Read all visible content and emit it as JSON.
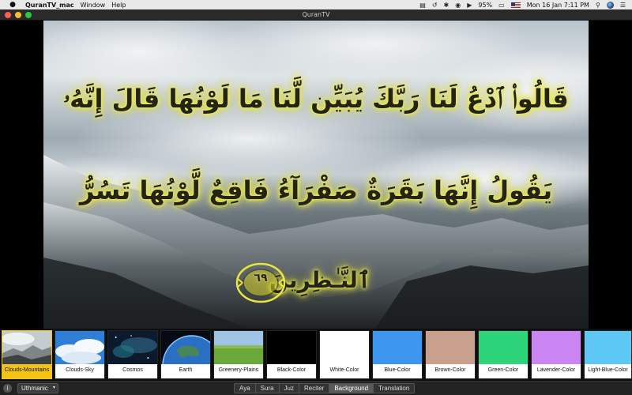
{
  "menubar": {
    "app_name": "QuranTV_mac",
    "menus": [
      "Window",
      "Help"
    ],
    "battery": "95%",
    "clock": "Mon 16 Jan  7:11 PM"
  },
  "window": {
    "title": "QuranTV"
  },
  "verses": {
    "line1": "قَالُوا۟ ٱدْعُ لَنَا رَبَّكَ يُبَيِّن لَّنَا مَا لَوْنُهَا قَالَ إِنَّهُۥ",
    "line2": "يَقُولُ إِنَّهَا بَقَرَةٌ صَفْرَآءُ فَاقِعٌ لَّوْنُهَا تَسُرُّ",
    "line3": "ٱلنَّـٰظِرِينَ",
    "ayah_number": "٦٩"
  },
  "backgrounds": [
    {
      "label": "Clouds-Mountains",
      "selected": true
    },
    {
      "label": "Clouds-Sky",
      "selected": false
    },
    {
      "label": "Cosmos",
      "selected": false
    },
    {
      "label": "Earth",
      "selected": false
    },
    {
      "label": "Greenery-Plains",
      "selected": false
    },
    {
      "label": "Black-Color",
      "color": "#000000",
      "selected": false
    },
    {
      "label": "White-Color",
      "color": "#ffffff",
      "selected": false
    },
    {
      "label": "Blue-Color",
      "color": "#3d96f0",
      "selected": false
    },
    {
      "label": "Brown-Color",
      "color": "#c9a08e",
      "selected": false
    },
    {
      "label": "Green-Color",
      "color": "#2ed47a",
      "selected": false
    },
    {
      "label": "Lavender-Color",
      "color": "#c986f2",
      "selected": false
    },
    {
      "label": "Light-Blue-Color",
      "color": "#5ec8f5",
      "selected": false
    }
  ],
  "bottombar": {
    "script_select": "Uthmanic",
    "tabs": [
      "Aya",
      "Sura",
      "Juz",
      "Reciter",
      "Background",
      "Translation"
    ],
    "active_tab": "Background"
  },
  "colors": {
    "glow": "#f4f26a",
    "selected": "#f3c316"
  }
}
